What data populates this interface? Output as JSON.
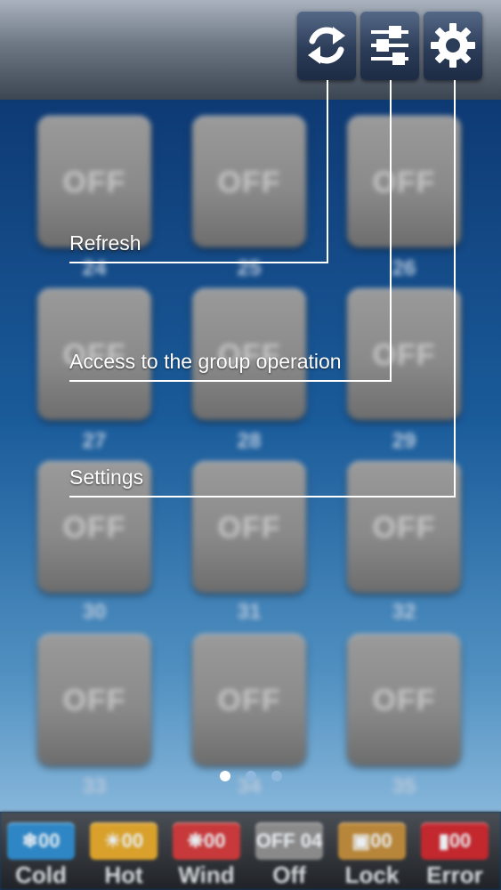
{
  "toolbar": {
    "buttons": [
      {
        "name": "refresh",
        "icon": "refresh-icon"
      },
      {
        "name": "group-operation",
        "icon": "sliders-icon"
      },
      {
        "name": "settings",
        "icon": "gear-icon"
      }
    ]
  },
  "tiles": [
    {
      "state": "OFF",
      "number": "24"
    },
    {
      "state": "OFF",
      "number": "25"
    },
    {
      "state": "OFF",
      "number": "26"
    },
    {
      "state": "OFF",
      "number": "27"
    },
    {
      "state": "OFF",
      "number": "28"
    },
    {
      "state": "OFF",
      "number": "29"
    },
    {
      "state": "OFF",
      "number": "30"
    },
    {
      "state": "OFF",
      "number": "31"
    },
    {
      "state": "OFF",
      "number": "32"
    },
    {
      "state": "OFF",
      "number": "33"
    },
    {
      "state": "OFF",
      "number": "34"
    },
    {
      "state": "OFF",
      "number": "35"
    }
  ],
  "pager": {
    "pages": 3,
    "active": 0
  },
  "callouts": {
    "refresh": "Refresh",
    "group": "Access to the group operation",
    "settings": "Settings"
  },
  "status": [
    {
      "icon": "snowflake-icon",
      "value": "00",
      "label": "Cold",
      "color": "#2f86c4"
    },
    {
      "icon": "sun-icon",
      "value": "00",
      "label": "Hot",
      "color": "#d9a12b"
    },
    {
      "icon": "fan-icon",
      "value": "00",
      "label": "Wind",
      "color": "#c7393a"
    },
    {
      "icon": "off-icon",
      "value": "OFF 04",
      "label": "Off",
      "color": "#8a8a8a"
    },
    {
      "icon": "lock-icon",
      "value": "00",
      "label": "Lock",
      "color": "#b8863a"
    },
    {
      "icon": "error-icon",
      "value": "00",
      "label": "Error",
      "color": "#c2282e"
    }
  ],
  "colors": {
    "header": "#6d7784",
    "background": "#1a5b9a",
    "tile": "#8a8a8a",
    "callout_line": "#ffffff"
  }
}
